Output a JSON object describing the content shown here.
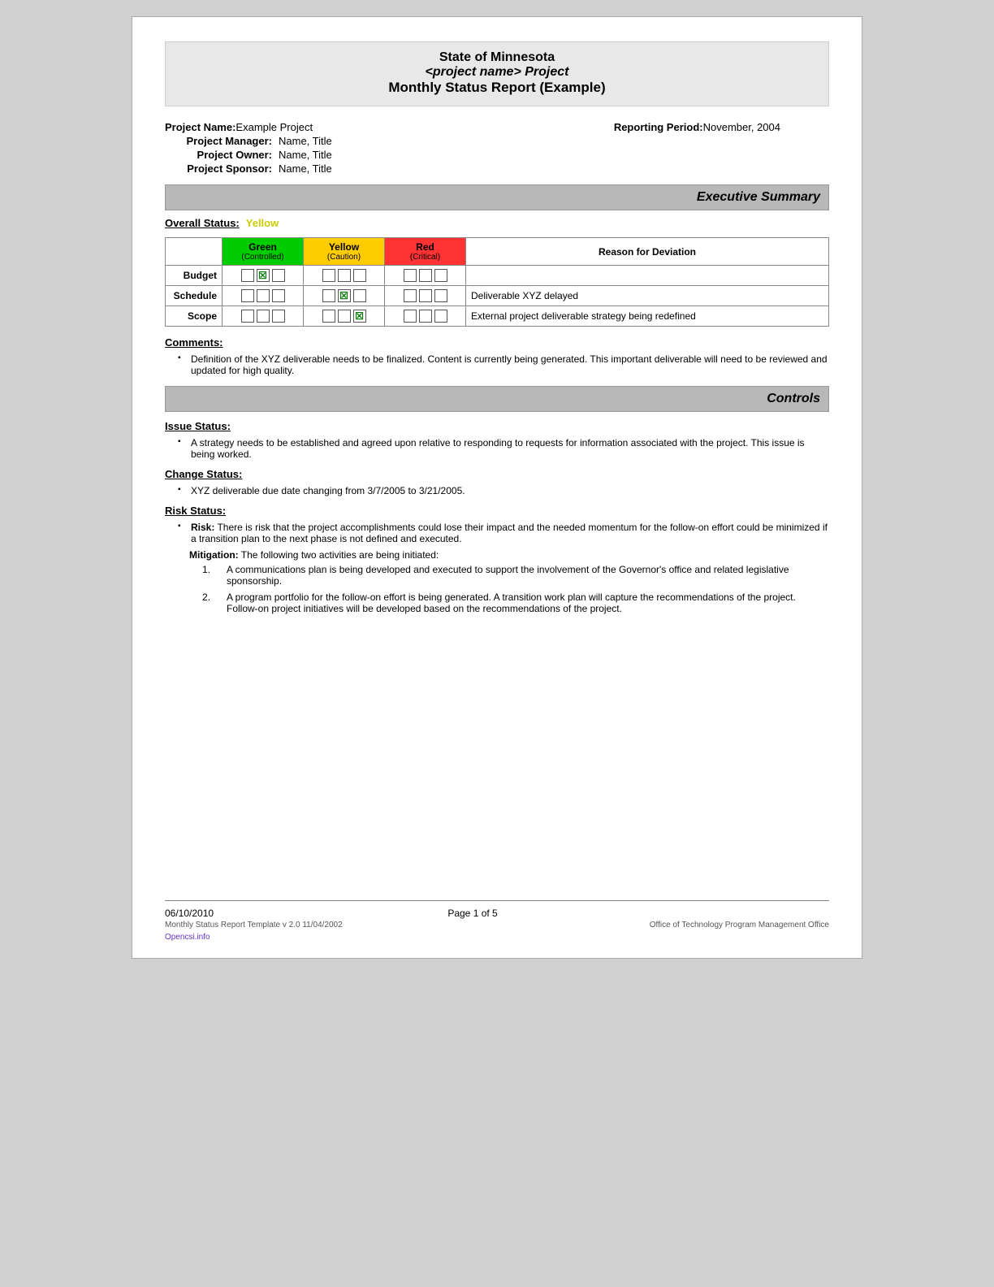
{
  "header": {
    "line1": "State of Minnesota",
    "line2": "<project name> Project",
    "line3": "Monthly Status Report (Example)"
  },
  "project_info": {
    "name_label": "Project Name:",
    "name_value": "Example Project",
    "reporting_period_label": "Reporting Period:",
    "reporting_period_value": "November, 2004",
    "manager_label": "Project Manager:",
    "manager_value": "Name, Title",
    "owner_label": "Project Owner:",
    "owner_value": "Name, Title",
    "sponsor_label": "Project Sponsor:",
    "sponsor_value": "Name, Title"
  },
  "executive_summary": {
    "title": "Executive Summary",
    "overall_status_label": "Overall Status:",
    "overall_status_value": "Yellow",
    "table": {
      "headers": {
        "col1": "",
        "col_green": "Green",
        "col_green_sub": "(Controlled)",
        "col_yellow": "Yellow",
        "col_yellow_sub": "(Caution)",
        "col_red": "Red",
        "col_red_sub": "(Critical)",
        "col_reason": "Reason for Deviation"
      },
      "rows": [
        {
          "label": "Budget",
          "green": [
            false,
            true,
            false
          ],
          "yellow": [
            false,
            false,
            false
          ],
          "red": [
            false,
            false,
            false
          ],
          "reason": ""
        },
        {
          "label": "Schedule",
          "green": [
            false,
            false,
            false
          ],
          "yellow": [
            false,
            true,
            false
          ],
          "red": [
            false,
            false,
            false
          ],
          "reason": "Deliverable XYZ delayed"
        },
        {
          "label": "Scope",
          "green": [
            false,
            false,
            false
          ],
          "yellow": [
            false,
            false,
            true
          ],
          "red": [
            false,
            false,
            false
          ],
          "reason": "External project deliverable strategy being redefined"
        }
      ]
    },
    "comments_label": "Comments:",
    "comments": [
      "Definition of the XYZ deliverable needs to be finalized.  Content is currently being generated.  This important deliverable will need to be reviewed and updated for high quality."
    ]
  },
  "controls": {
    "title": "Controls",
    "issue_status_label": "Issue Status:",
    "issue_items": [
      "A strategy needs to be established and agreed upon relative to responding to requests for information associated with the project.  This issue is being worked."
    ],
    "change_status_label": "Change Status:",
    "change_items": [
      "XYZ deliverable due date changing from 3/7/2005 to 3/21/2005."
    ],
    "risk_status_label": "Risk Status:",
    "risk_prefix": "Risk:",
    "risk_text": " There is risk that the project accomplishments could lose their impact and the needed momentum for the follow-on effort could be minimized if a transition plan to the next phase is not defined and executed.",
    "mitigation_prefix": "Mitigation:",
    "mitigation_text": "  The following two activities are being initiated:",
    "mitigation_items": [
      "A communications plan is being developed and executed to support the involvement of the Governor's office and related legislative sponsorship.",
      "A program portfolio for the follow-on effort is being generated. A transition work plan will capture the recommendations of the project. Follow-on project initiatives will be developed based on the recommendations of the project."
    ]
  },
  "footer": {
    "date": "06/10/2010",
    "page": "Page 1 of 5",
    "template": "Monthly Status Report Template  v 2.0  11/04/2002",
    "office": "Office of Technology Program Management Office",
    "watermark": "Opencsi.info"
  }
}
